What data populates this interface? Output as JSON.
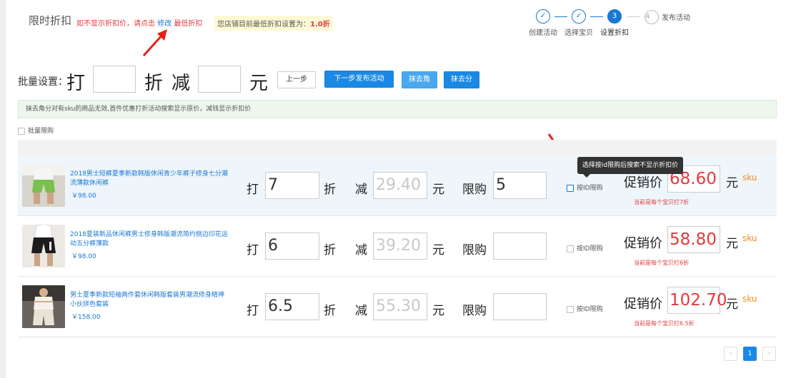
{
  "header": {
    "title": "限时折扣",
    "warn_prefix": "如不显示折扣价，请点击",
    "warn_edit": "修改",
    "warn_suffix": "最低折扣",
    "info_prefix": "您店铺目前最低折扣设置为：",
    "info_value": "1.0折"
  },
  "steps": [
    {
      "num": "✓",
      "label": "创建活动"
    },
    {
      "num": "✓",
      "label": "选择宝贝"
    },
    {
      "num": "3",
      "label": "设置折扣"
    },
    {
      "num": "4",
      "label": "发布活动"
    }
  ],
  "batch": {
    "label": "批量设置：",
    "da": "打",
    "zhe": "折",
    "jian": "减",
    "yuan": "元",
    "btn_prev": "上一步",
    "btn_next": "下一步发布活动",
    "btn_jiao": "抹去角",
    "btn_fen": "抹去分"
  },
  "notice": "抹去角分对有sku的商品无效,首件优惠打折活动搜索显示原价，减钱显示折扣价",
  "batch_limit_label": "批量限购",
  "tooltip": "选择按id限购后搜索不显示折扣价",
  "row_labels": {
    "da": "打",
    "zhe": "折",
    "jian": "减",
    "yuan": "元",
    "xiangou": "限购",
    "id_limit": "按ID限购",
    "promo": "促销价",
    "sku": "sku"
  },
  "products": [
    {
      "name": "2018男士短裤夏季新款韩版休闲青少年裤子修身七分潮流薄款休闲裤",
      "price": "￥98.00",
      "discount": "7",
      "reduce": "29.40",
      "limit": "5",
      "promo": "68.60",
      "note": "当前是每个宝贝打7折"
    },
    {
      "name": "2018夏装新品休闲裤男士修身韩版潮流简约侧边印花运动五分裤薄款",
      "price": "￥98.00",
      "discount": "6",
      "reduce": "39.20",
      "limit": "",
      "promo": "58.80",
      "note": "当前是每个宝贝打6折"
    },
    {
      "name": "男士夏季新款短袖两件套休闲韩版套装男潮流修身精神小伙拼色套装",
      "price": "￥158.00",
      "discount": "6.5",
      "reduce": "55.30",
      "limit": "",
      "promo": "102.70",
      "note": "当前是每个宝贝打6.5折"
    }
  ],
  "pager": {
    "prev": "‹",
    "page": "1",
    "next": "›"
  },
  "colors": {
    "primary": "#1a89e6",
    "danger": "#e4393c",
    "sku": "#f08c1d",
    "notice_bg": "#edf7ee"
  }
}
